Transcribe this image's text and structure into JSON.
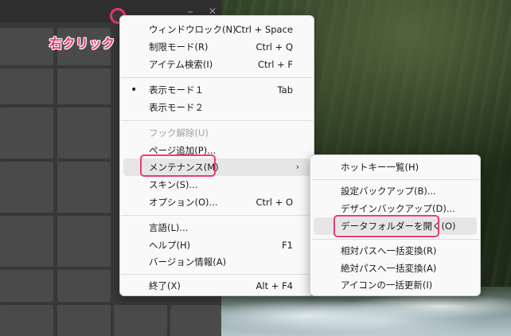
{
  "annotation": {
    "right_click_label": "右クリック"
  },
  "app_window": {
    "titlebar_glyphs": [
      "⎯",
      "⧉",
      "✕"
    ]
  },
  "main_menu": {
    "items": [
      {
        "label": "ウィンドウロック(N)",
        "shortcut": "Ctrl + Space"
      },
      {
        "label": "制限モード(R)",
        "shortcut": "Ctrl + Q"
      },
      {
        "label": "アイテム検索(I)",
        "shortcut": "Ctrl + F"
      },
      {
        "label": "表示モード１",
        "shortcut": "Tab",
        "bullet": "•"
      },
      {
        "label": "表示モード２",
        "shortcut": ""
      },
      {
        "label": "フック解除(U)",
        "shortcut": "",
        "disabled": true
      },
      {
        "label": "ページ追加(P)...",
        "shortcut": ""
      },
      {
        "label": "メンテナンス(M)",
        "shortcut": "",
        "submenu_arrow": "›"
      },
      {
        "label": "スキン(S)...",
        "shortcut": ""
      },
      {
        "label": "オプション(O)...",
        "shortcut": "Ctrl + O"
      },
      {
        "label": "言語(L)...",
        "shortcut": ""
      },
      {
        "label": "ヘルプ(H)",
        "shortcut": "F1"
      },
      {
        "label": "バージョン情報(A)",
        "shortcut": ""
      },
      {
        "label": "終了(X)",
        "shortcut": "Alt + F4"
      }
    ]
  },
  "submenu": {
    "items": [
      {
        "label": "ホットキー一覧(H)"
      },
      {
        "label": "設定バックアップ(B)..."
      },
      {
        "label": "デザインバックアップ(D)..."
      },
      {
        "label": "データフォルダーを開く(O)"
      },
      {
        "label": "相対パスへ一括変換(R)"
      },
      {
        "label": "絶対パスへ一括変換(A)"
      },
      {
        "label": "アイコンの一括更新(I)"
      }
    ]
  },
  "colors": {
    "annotation_pink": "#ec3a78",
    "menu_bg": "#f9f9f9",
    "app_bg": "#383838"
  }
}
